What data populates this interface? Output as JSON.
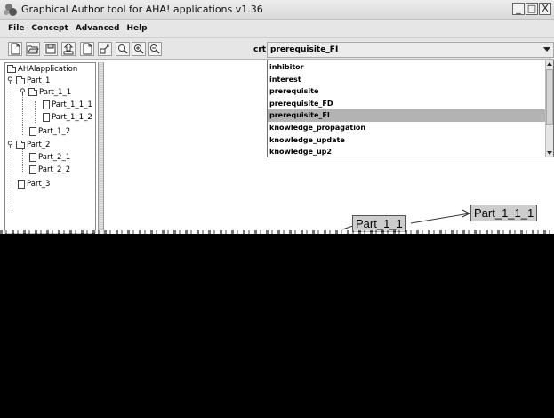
{
  "window": {
    "title": "Graphical Author tool for AHA! applications v1.36",
    "controls": [
      "_",
      "□",
      "X"
    ]
  },
  "menu": {
    "items": [
      "File",
      "Concept",
      "Advanced",
      "Help"
    ]
  },
  "toolbar": {
    "buttons": [
      "new-concept-icon",
      "open-icon",
      "save-icon",
      "export-icon",
      "new-page-icon",
      "link-icon",
      "search-icon",
      "zoom-in-icon",
      "zoom-out-icon"
    ],
    "crt_label": "crt:",
    "crt_value": "prerequisite_FI"
  },
  "tree": {
    "items": [
      {
        "label": "AHAlapplication",
        "type": "folder"
      },
      {
        "label": "Part_1",
        "type": "folder"
      },
      {
        "label": "Part_1_1",
        "type": "folder"
      },
      {
        "label": "Part_1_1_1",
        "type": "doc"
      },
      {
        "label": "Part_1_1_2",
        "type": "doc"
      },
      {
        "label": "Part_1_2",
        "type": "doc"
      },
      {
        "label": "Part_2",
        "type": "folder"
      },
      {
        "label": "Part_2_1",
        "type": "doc"
      },
      {
        "label": "Part_2_2",
        "type": "doc"
      },
      {
        "label": "Part_3",
        "type": "doc"
      }
    ]
  },
  "dropdown": {
    "options": [
      "inhibitor",
      "interest",
      "prerequisite",
      "prerequisite_FD",
      "prerequisite_FI",
      "knowledge_propagation",
      "knowledge_update",
      "knowledge_up2"
    ],
    "selected": "prerequisite_FI"
  },
  "canvas": {
    "nodes": [
      {
        "label": "Part_1_1"
      },
      {
        "label": "Part_1_1_1"
      }
    ]
  }
}
